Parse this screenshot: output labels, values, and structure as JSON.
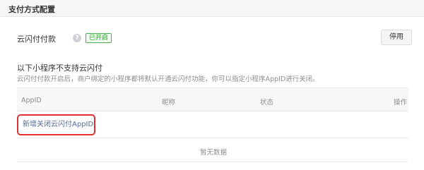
{
  "section": {
    "title": "支付方式配置"
  },
  "payment_method": {
    "label": "云闪付付款",
    "help_icon": "question-mark-icon",
    "status": "已开启",
    "disable_button": "停用"
  },
  "unsupported": {
    "title": "以下小程序不支持云闪付",
    "description": "云闪付付款开启后，商户绑定的小程序都将默认开通云闪付功能，你可以指定小程序AppID进行关闭。"
  },
  "table": {
    "columns": [
      "AppID",
      "昵称",
      "状态",
      "操作"
    ],
    "add_link": "新增关闭云闪付AppID",
    "empty_text": "暂无数据"
  },
  "colors": {
    "accent_link": "#576b95",
    "status_green": "#1aad19",
    "highlight_red": "#e03131"
  }
}
